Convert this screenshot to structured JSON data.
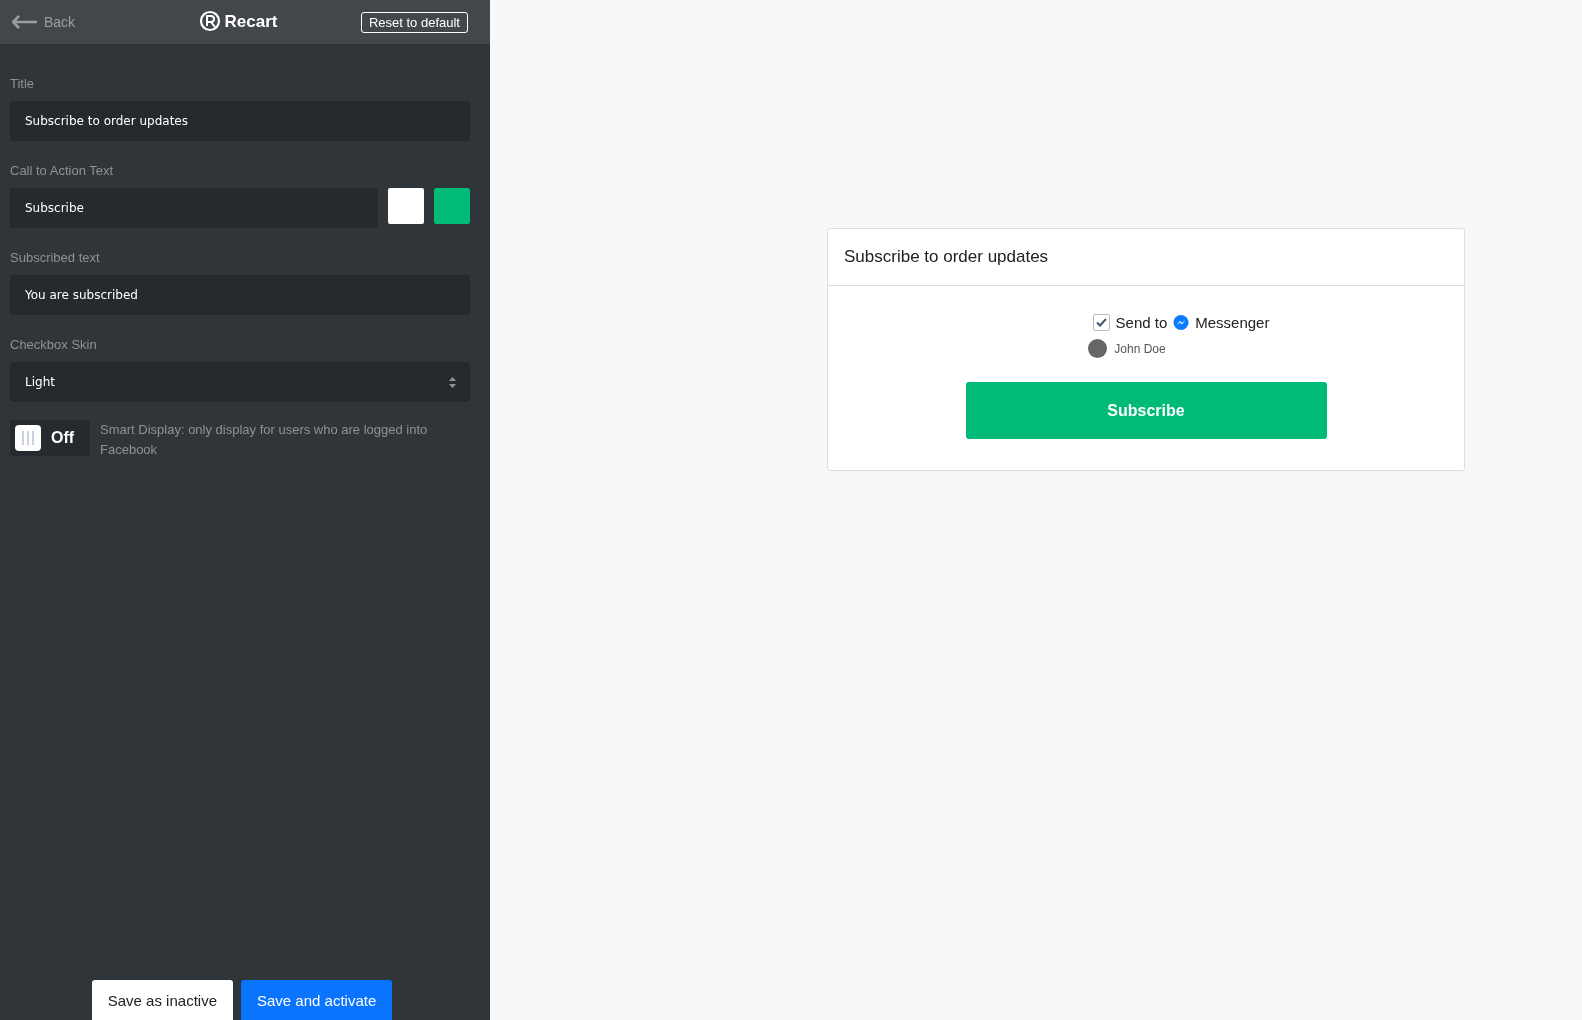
{
  "header": {
    "back": "Back",
    "brand": "Recart",
    "reset": "Reset to default"
  },
  "fields": [
    {
      "kind": "text",
      "label": "Title",
      "value": "Subscribe to order updates"
    },
    {
      "kind": "color-text",
      "label": "Call to Action Text",
      "value": "Subscribe",
      "swatches": [
        {
          "color": "#ffffff"
        },
        {
          "color": "#00bb77"
        }
      ]
    },
    {
      "kind": "text",
      "label": "Subscribed text",
      "value": "You are subscribed"
    },
    {
      "kind": "select",
      "label": "Checkbox Skin",
      "value": "Light"
    }
  ],
  "smart_display": {
    "on": false,
    "label": "Off",
    "description": "Smart Display: only display for users who are logged into Facebook"
  },
  "buttons": [
    {
      "kind": "secondary",
      "label": "Save as inactive"
    },
    {
      "kind": "primary",
      "label": "Save and activate"
    }
  ],
  "preview": {
    "title": "Subscribe to order updates",
    "checked": true,
    "send_to": "Send to",
    "messenger": "Messenger",
    "user": "John Doe",
    "button": "Subscribe"
  }
}
